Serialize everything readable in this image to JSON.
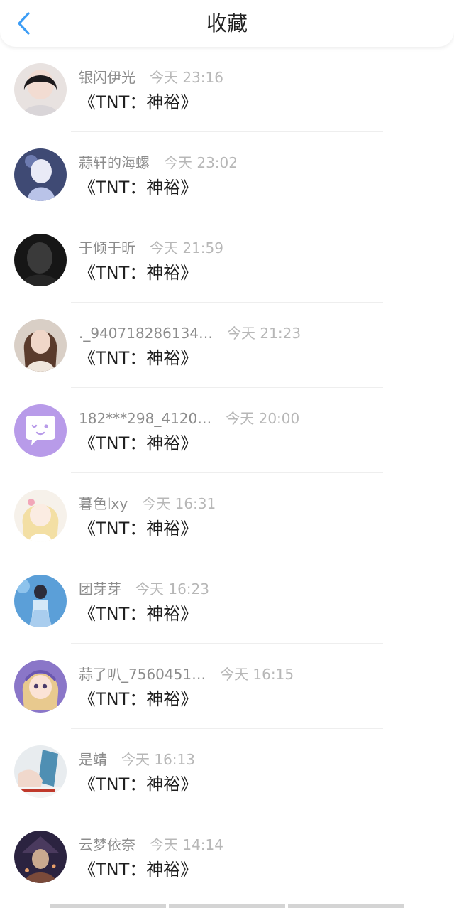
{
  "header": {
    "title": "收藏",
    "back_icon": "chevron-left-icon",
    "back_color": "#3c9df6"
  },
  "items": [
    {
      "name": "银闪伊光",
      "time": "今天 23:16",
      "subject": "《TNT：神裕》"
    },
    {
      "name": "蒜轩的海螺",
      "time": "今天 23:02",
      "subject": "《TNT：神裕》"
    },
    {
      "name": "于倾于昕",
      "time": "今天 21:59",
      "subject": "《TNT：神裕》"
    },
    {
      "name": "._940718286134…",
      "time": "今天 21:23",
      "subject": "《TNT：神裕》"
    },
    {
      "name": "182***298_4120…",
      "time": "今天 20:00",
      "subject": "《TNT：神裕》"
    },
    {
      "name": "暮色lxy",
      "time": "今天 16:31",
      "subject": "《TNT：神裕》"
    },
    {
      "name": "团芽芽",
      "time": "今天 16:23",
      "subject": "《TNT：神裕》"
    },
    {
      "name": "蒜了叭_7560451…",
      "time": "今天 16:15",
      "subject": "《TNT：神裕》"
    },
    {
      "name": "是靖",
      "time": "今天 16:13",
      "subject": "《TNT：神裕》"
    },
    {
      "name": "云梦依奈",
      "time": "今天 14:14",
      "subject": "《TNT：神裕》"
    }
  ]
}
